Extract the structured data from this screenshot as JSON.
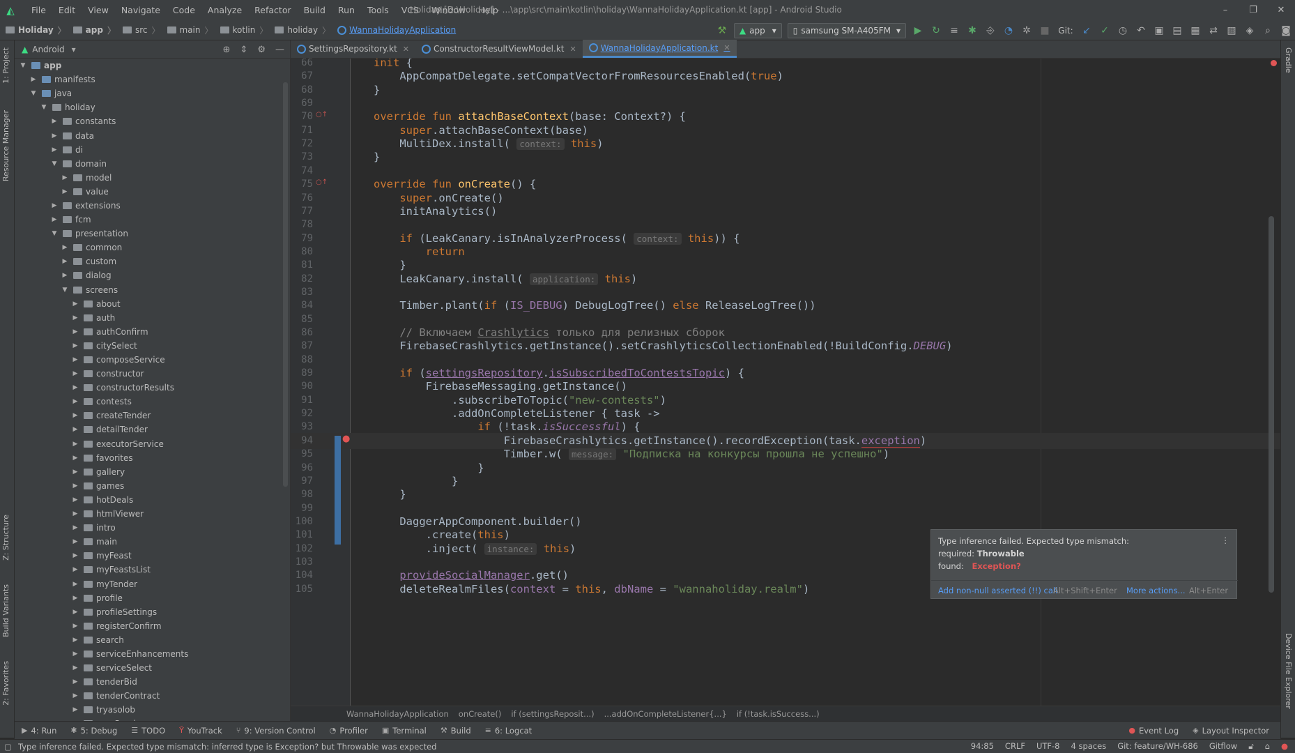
{
  "menubar": {
    "items": [
      "File",
      "Edit",
      "View",
      "Navigate",
      "Code",
      "Analyze",
      "Refactor",
      "Build",
      "Run",
      "Tools",
      "VCS",
      "Window",
      "Help"
    ],
    "window_title": "Holiday [D:\\Holiday] - ...\\app\\src\\main\\kotlin\\holiday\\WannaHolidayApplication.kt [app] - Android Studio"
  },
  "navbar": {
    "breadcrumbs": [
      "Holiday",
      "app",
      "src",
      "main",
      "kotlin",
      "holiday",
      "WannaHolidayApplication"
    ],
    "run_config": "app",
    "device": "samsung SM-A405FM",
    "git_label": "Git:"
  },
  "left_strip": {
    "tabs": [
      "1: Project",
      "Resource Manager",
      "Z: Structure",
      "Build Variants",
      "2: Favorites"
    ]
  },
  "right_strip": {
    "tabs": [
      "Gradle",
      "Device File Explorer"
    ]
  },
  "project": {
    "view_mode": "Android",
    "tree": [
      {
        "label": "app",
        "depth": 0,
        "open": true,
        "bold": true
      },
      {
        "label": "manifests",
        "depth": 1,
        "open": false
      },
      {
        "label": "java",
        "depth": 1,
        "open": true
      },
      {
        "label": "holiday",
        "depth": 2,
        "open": true
      },
      {
        "label": "constants",
        "depth": 3,
        "open": false
      },
      {
        "label": "data",
        "depth": 3,
        "open": false
      },
      {
        "label": "di",
        "depth": 3,
        "open": false
      },
      {
        "label": "domain",
        "depth": 3,
        "open": true
      },
      {
        "label": "model",
        "depth": 4,
        "open": false
      },
      {
        "label": "value",
        "depth": 4,
        "open": false
      },
      {
        "label": "extensions",
        "depth": 3,
        "open": false
      },
      {
        "label": "fcm",
        "depth": 3,
        "open": false
      },
      {
        "label": "presentation",
        "depth": 3,
        "open": true
      },
      {
        "label": "common",
        "depth": 4,
        "open": false
      },
      {
        "label": "custom",
        "depth": 4,
        "open": false
      },
      {
        "label": "dialog",
        "depth": 4,
        "open": false
      },
      {
        "label": "screens",
        "depth": 4,
        "open": true
      },
      {
        "label": "about",
        "depth": 5,
        "open": false
      },
      {
        "label": "auth",
        "depth": 5,
        "open": false
      },
      {
        "label": "authConfirm",
        "depth": 5,
        "open": false
      },
      {
        "label": "citySelect",
        "depth": 5,
        "open": false
      },
      {
        "label": "composeService",
        "depth": 5,
        "open": false
      },
      {
        "label": "constructor",
        "depth": 5,
        "open": false
      },
      {
        "label": "constructorResults",
        "depth": 5,
        "open": false
      },
      {
        "label": "contests",
        "depth": 5,
        "open": false
      },
      {
        "label": "createTender",
        "depth": 5,
        "open": false
      },
      {
        "label": "detailTender",
        "depth": 5,
        "open": false
      },
      {
        "label": "executorService",
        "depth": 5,
        "open": false
      },
      {
        "label": "favorites",
        "depth": 5,
        "open": false
      },
      {
        "label": "gallery",
        "depth": 5,
        "open": false
      },
      {
        "label": "games",
        "depth": 5,
        "open": false
      },
      {
        "label": "hotDeals",
        "depth": 5,
        "open": false
      },
      {
        "label": "htmlViewer",
        "depth": 5,
        "open": false
      },
      {
        "label": "intro",
        "depth": 5,
        "open": false
      },
      {
        "label": "main",
        "depth": 5,
        "open": false
      },
      {
        "label": "myFeast",
        "depth": 5,
        "open": false
      },
      {
        "label": "myFeastsList",
        "depth": 5,
        "open": false
      },
      {
        "label": "myTender",
        "depth": 5,
        "open": false
      },
      {
        "label": "profile",
        "depth": 5,
        "open": false
      },
      {
        "label": "profileSettings",
        "depth": 5,
        "open": false
      },
      {
        "label": "registerConfirm",
        "depth": 5,
        "open": false
      },
      {
        "label": "search",
        "depth": 5,
        "open": false
      },
      {
        "label": "serviceEnhancements",
        "depth": 5,
        "open": false
      },
      {
        "label": "serviceSelect",
        "depth": 5,
        "open": false
      },
      {
        "label": "tenderBid",
        "depth": 5,
        "open": false
      },
      {
        "label": "tenderContract",
        "depth": 5,
        "open": false
      },
      {
        "label": "tryasolob",
        "depth": 5,
        "open": false
      },
      {
        "label": "userService",
        "depth": 5,
        "open": false
      }
    ]
  },
  "editor_tabs": [
    {
      "label": "SettingsRepository.kt",
      "active": false
    },
    {
      "label": "ConstructorResultViewModel.kt",
      "active": false
    },
    {
      "label": "WannaHolidayApplication.kt",
      "active": true
    }
  ],
  "code": {
    "current_line": "94",
    "lines": [
      {
        "n": "66",
        "html": "<span class='kw'>init</span> {"
      },
      {
        "n": "67",
        "html": "    AppCompatDelegate.setCompatVectorFromResourcesEnabled(<span class='kw'>true</span>)"
      },
      {
        "n": "68",
        "html": "}"
      },
      {
        "n": "69",
        "html": ""
      },
      {
        "n": "70",
        "html": "<span class='kw'>override fun</span> <span class='fn'>attachBaseContext</span>(base: Context?) {"
      },
      {
        "n": "71",
        "html": "    <span class='kw'>super</span>.attachBaseContext(base)"
      },
      {
        "n": "72",
        "html": "    MultiDex.install( <span class='hint'>context:</span> <span class='kw'>this</span>)"
      },
      {
        "n": "73",
        "html": "}"
      },
      {
        "n": "74",
        "html": ""
      },
      {
        "n": "75",
        "html": "<span class='kw'>override fun</span> <span class='fn'>onCreate</span>() {"
      },
      {
        "n": "76",
        "html": "    <span class='kw'>super</span>.onCreate()"
      },
      {
        "n": "77",
        "html": "    initAnalytics()"
      },
      {
        "n": "78",
        "html": ""
      },
      {
        "n": "79",
        "html": "    <span class='kw'>if</span> (LeakCanary.isInAnalyzerProcess( <span class='hint'>context:</span> <span class='kw'>this</span>)) {"
      },
      {
        "n": "80",
        "html": "        <span class='kw'>return</span>"
      },
      {
        "n": "81",
        "html": "    }"
      },
      {
        "n": "82",
        "html": "    LeakCanary.install( <span class='hint'>application:</span> <span class='kw'>this</span>)"
      },
      {
        "n": "83",
        "html": ""
      },
      {
        "n": "84",
        "html": "    Timber.plant(<span class='kw'>if</span> (<span class='prop'>IS_DEBUG</span>) DebugLogTree() <span class='kw'>else</span> ReleaseLogTree())"
      },
      {
        "n": "85",
        "html": ""
      },
      {
        "n": "86",
        "html": "    <span class='com'>// Включаем <u>Crashlytics</u> только для релизных сборок</span>"
      },
      {
        "n": "87",
        "html": "    FirebaseCrashlytics.getInstance().setCrashlyticsCollectionEnabled(!BuildConfig.<span class='prop it'>DEBUG</span>)"
      },
      {
        "n": "88",
        "html": ""
      },
      {
        "n": "89",
        "html": "    <span class='kw'>if</span> (<span class='link'>settingsRepository</span>.<span class='link'>isSubscribedToContestsTopic</span>) {"
      },
      {
        "n": "90",
        "html": "        FirebaseMessaging.getInstance()"
      },
      {
        "n": "91",
        "html": "            .subscribeToTopic(<span class='str'>\"new-contests\"</span>)"
      },
      {
        "n": "92",
        "html": "            .addOnCompleteListener { task -&gt;"
      },
      {
        "n": "93",
        "html": "                <span class='kw'>if</span> (!task.<span class='prop it'>isSuccessful</span>) {"
      },
      {
        "n": "94",
        "html": "                    FirebaseCrashlytics.getInstance().recordException(task.<span class='prop' style='border-bottom:1px solid #bc3f3c'>exception</span>)"
      },
      {
        "n": "95",
        "html": "                    Timber.w( <span class='hint'>message:</span> <span class='str'>\"Подписка на конкурсы прошла не успешно\"</span>)"
      },
      {
        "n": "96",
        "html": "                }"
      },
      {
        "n": "97",
        "html": "            }"
      },
      {
        "n": "98",
        "html": "    }"
      },
      {
        "n": "99",
        "html": ""
      },
      {
        "n": "100",
        "html": "    DaggerAppComponent.builder()"
      },
      {
        "n": "101",
        "html": "        .create(<span class='kw'>this</span>)"
      },
      {
        "n": "102",
        "html": "        .inject( <span class='hint'>instance:</span> <span class='kw'>this</span>)"
      },
      {
        "n": "103",
        "html": ""
      },
      {
        "n": "104",
        "html": "    <span class='link'>provideSocialManager</span>.get()"
      },
      {
        "n": "105",
        "html": "    deleteRealmFiles(<span class='prop'>context</span> = <span class='kw'>this</span>, <span class='prop'>dbName</span> = <span class='str'>\"wannaholiday.realm\"</span>)"
      }
    ]
  },
  "popup": {
    "title": "Type inference failed. Expected type mismatch:",
    "required_label": "required:",
    "required_value": "Throwable",
    "found_label": "found:",
    "found_value": "Exception?",
    "action1": "Add non-null asserted (!!) call",
    "action1_shortcut": "Alt+Shift+Enter",
    "action2": "More actions...",
    "action2_shortcut": "Alt+Enter"
  },
  "editor_breadcrumbs": [
    "WannaHolidayApplication",
    "onCreate()",
    "if (settingsReposit...)",
    "...addOnCompleteListener{...}",
    "if (!task.isSuccess...)"
  ],
  "bottom_tabs": [
    "4: Run",
    "5: Debug",
    "TODO",
    "YouTrack",
    "9: Version Control",
    "Profiler",
    "Terminal",
    "Build",
    "6: Logcat"
  ],
  "bottom_right_tabs": [
    "Event Log",
    "Layout Inspector"
  ],
  "status": {
    "message": "Type inference failed. Expected type mismatch: inferred type is Exception? but Throwable was expected",
    "position": "94:85",
    "line_sep": "CRLF",
    "encoding": "UTF-8",
    "indent": "4 spaces",
    "git_branch": "Git: feature/WH-686",
    "gitflow": "Gitflow"
  },
  "colors": {
    "accent": "#4a88c7",
    "keyword": "#cc7832",
    "string": "#6a8759",
    "error": "#e05555"
  }
}
